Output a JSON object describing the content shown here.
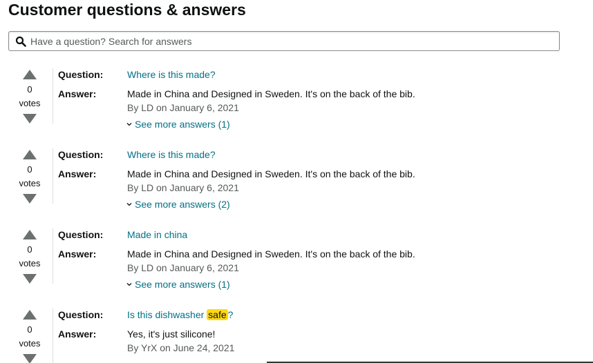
{
  "header": {
    "title": "Customer questions & answers"
  },
  "search": {
    "placeholder": "Have a question? Search for answers",
    "icon": "search-icon"
  },
  "labels": {
    "question": "Question:",
    "answer": "Answer:",
    "votes": "votes"
  },
  "qa": [
    {
      "votes": "0",
      "question": "Where is this made?",
      "answer": "Made in China and Designed in Sweden. It's on the back of the bib.",
      "byline": "By LD on January 6, 2021",
      "more": "See more answers (1)"
    },
    {
      "votes": "0",
      "question": "Where is this made?",
      "answer": "Made in China and Designed in Sweden. It's on the back of the bib.",
      "byline": "By LD on January 6, 2021",
      "more": "See more answers (2)"
    },
    {
      "votes": "0",
      "question": "Made in china",
      "answer": "Made in China and Designed in Sweden. It's on the back of the bib.",
      "byline": "By LD on January 6, 2021",
      "more": "See more answers (1)"
    },
    {
      "votes": "0",
      "question_before": "Is this dishwasher ",
      "question_highlight": "safe",
      "question_after": "?",
      "answer": "Yes, it's just silicone!",
      "byline": "By YrX on June 24, 2021"
    }
  ],
  "colors": {
    "link": "#007185",
    "highlight": "#ffd814",
    "text": "#0f1111",
    "muted": "#565959",
    "arrow": "#6c7070"
  }
}
